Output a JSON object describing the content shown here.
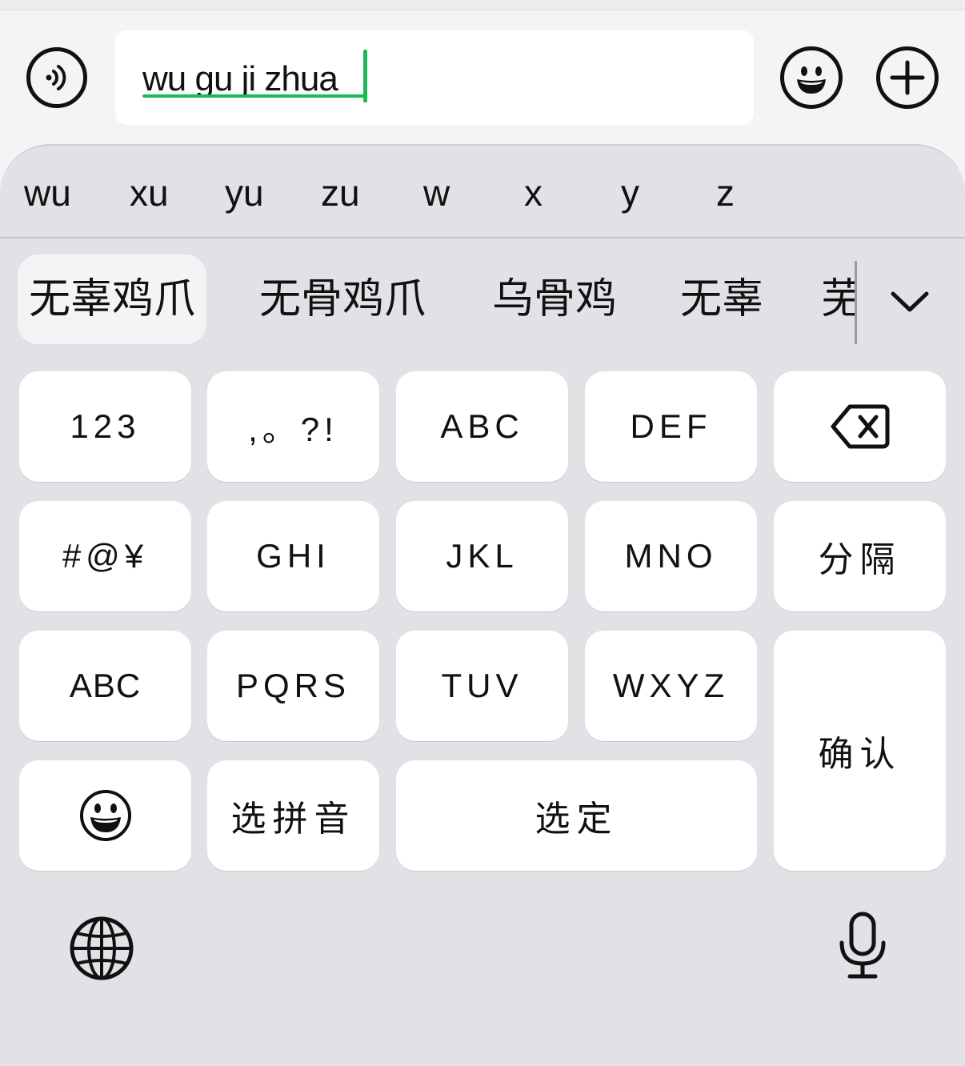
{
  "input": {
    "composing_text": "wu gu ji zhua",
    "left_icon": "voice-input-icon",
    "emoji_icon": "emoji-icon",
    "plus_icon": "add-icon"
  },
  "pinyin_options": [
    "wu",
    "xu",
    "yu",
    "zu",
    "w",
    "x",
    "y",
    "z"
  ],
  "candidates": {
    "items": [
      "无辜鸡爪",
      "无骨鸡爪",
      "乌骨鸡",
      "无辜",
      "芜"
    ],
    "selected_index": 0,
    "expand_icon": "chevron-down-icon"
  },
  "keys": {
    "row1": [
      "123",
      ",。?!",
      "ABC",
      "DEF"
    ],
    "delete_icon": "backspace-icon",
    "row2": [
      "#@¥",
      "GHI",
      "JKL",
      "MNO",
      "分隔"
    ],
    "row3": [
      "ABC",
      "PQRS",
      "TUV",
      "WXYZ"
    ],
    "confirm": "确认",
    "emoji_key_icon": "emoji-icon",
    "select_pinyin": "选拼音",
    "select": "选定"
  },
  "bottom_bar": {
    "globe_icon": "globe-icon",
    "mic_icon": "microphone-icon"
  },
  "colors": {
    "accent": "#1db954",
    "keyboard_bg": "#e1e1e6",
    "key_bg": "#ffffff"
  }
}
